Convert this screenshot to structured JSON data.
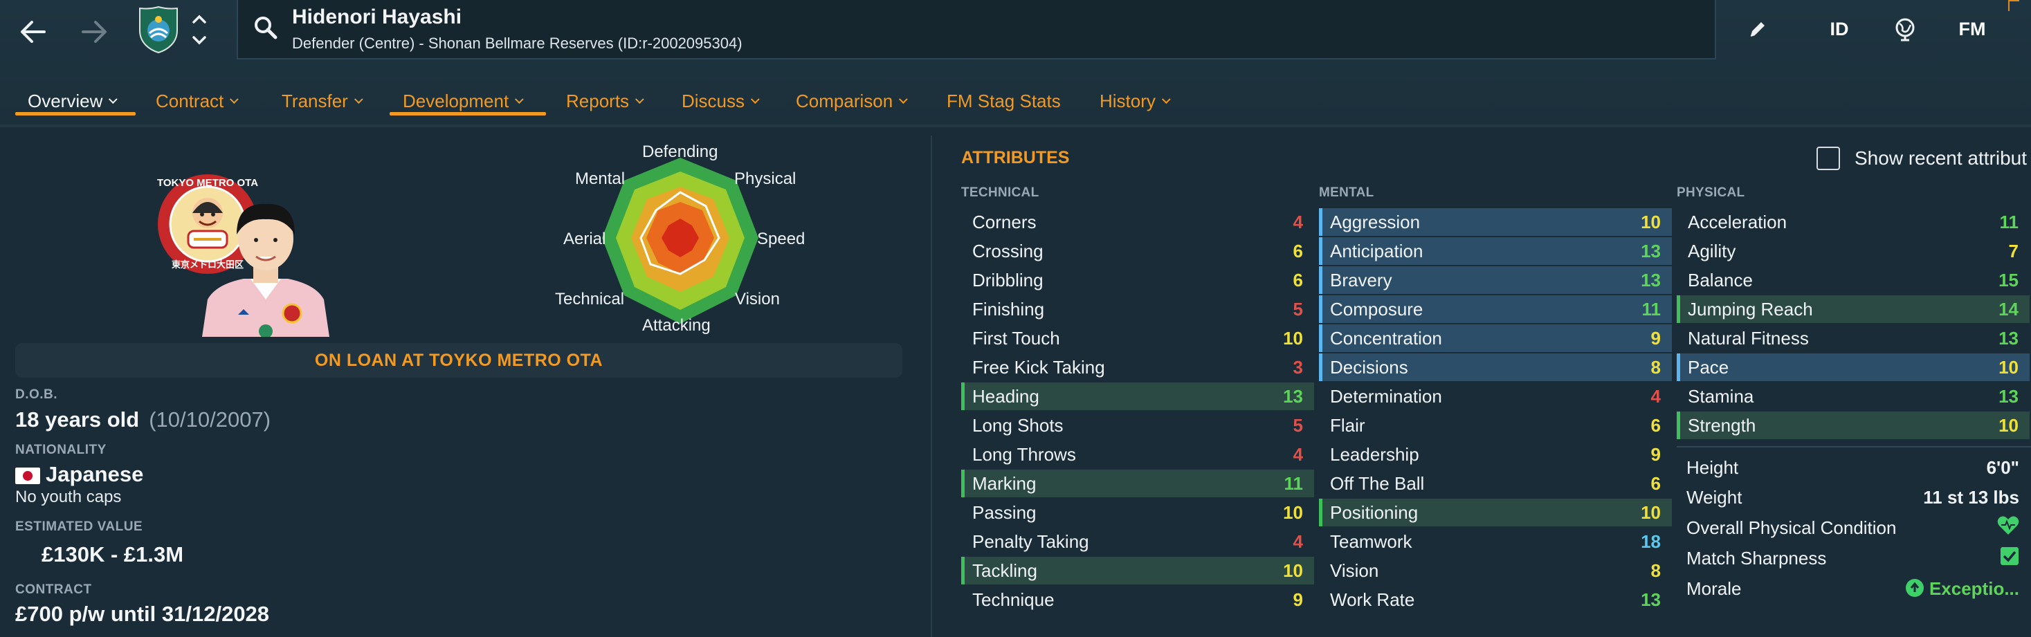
{
  "header": {
    "player_name": "Hidenori Hayashi",
    "player_subtitle": "Defender (Centre) - Shonan Bellmare Reserves (ID:r-2002095304)",
    "id_button": "ID",
    "fm_button": "FM"
  },
  "tabs": [
    {
      "label": "Overview",
      "active": true
    },
    {
      "label": "Contract"
    },
    {
      "label": "Transfer"
    },
    {
      "label": "Development",
      "highlighted": true
    },
    {
      "label": "Reports"
    },
    {
      "label": "Discuss"
    },
    {
      "label": "Comparison"
    },
    {
      "label": "FM Stag Stats"
    },
    {
      "label": "History"
    }
  ],
  "profile": {
    "loan_status": "ON LOAN AT TOYKO METRO OTA",
    "dob_label": "D.O.B.",
    "age": "18 years old",
    "dob": "(10/10/2007)",
    "nationality_label": "NATIONALITY",
    "nationality": "Japanese",
    "youth_caps": "No youth caps",
    "value_label": "ESTIMATED VALUE",
    "value": "£130K - £1.3M",
    "contract_label": "CONTRACT",
    "contract": "£700 p/w until 31/12/2028",
    "loan_club_badge_text": "TOKYO METRO OTA",
    "loan_club_badge_subtext": "東京メトロ大田区"
  },
  "radar": {
    "labels": [
      "Defending",
      "Physical",
      "Speed",
      "Vision",
      "Attacking",
      "Technical",
      "Aerial",
      "Mental"
    ]
  },
  "attributes": {
    "title": "ATTRIBUTES",
    "show_recent_label": "Show recent attribut",
    "technical_label": "TECHNICAL",
    "mental_label": "MENTAL",
    "physical_label": "PHYSICAL",
    "technical": [
      {
        "name": "Corners",
        "value": "4"
      },
      {
        "name": "Crossing",
        "value": "6"
      },
      {
        "name": "Dribbling",
        "value": "6"
      },
      {
        "name": "Finishing",
        "value": "5"
      },
      {
        "name": "First Touch",
        "value": "10"
      },
      {
        "name": "Free Kick Taking",
        "value": "3"
      },
      {
        "name": "Heading",
        "value": "13",
        "highlight": "green"
      },
      {
        "name": "Long Shots",
        "value": "5"
      },
      {
        "name": "Long Throws",
        "value": "4"
      },
      {
        "name": "Marking",
        "value": "11",
        "highlight": "green"
      },
      {
        "name": "Passing",
        "value": "10"
      },
      {
        "name": "Penalty Taking",
        "value": "4"
      },
      {
        "name": "Tackling",
        "value": "10",
        "highlight": "green"
      },
      {
        "name": "Technique",
        "value": "9"
      }
    ],
    "mental": [
      {
        "name": "Aggression",
        "value": "10",
        "highlight": "blue"
      },
      {
        "name": "Anticipation",
        "value": "13",
        "highlight": "blue"
      },
      {
        "name": "Bravery",
        "value": "13",
        "highlight": "blue"
      },
      {
        "name": "Composure",
        "value": "11",
        "highlight": "blue"
      },
      {
        "name": "Concentration",
        "value": "9",
        "highlight": "blue"
      },
      {
        "name": "Decisions",
        "value": "8",
        "highlight": "blue"
      },
      {
        "name": "Determination",
        "value": "4"
      },
      {
        "name": "Flair",
        "value": "6"
      },
      {
        "name": "Leadership",
        "value": "9"
      },
      {
        "name": "Off The Ball",
        "value": "6"
      },
      {
        "name": "Positioning",
        "value": "10",
        "highlight": "green"
      },
      {
        "name": "Teamwork",
        "value": "18"
      },
      {
        "name": "Vision",
        "value": "8"
      },
      {
        "name": "Work Rate",
        "value": "13"
      }
    ],
    "physical": [
      {
        "name": "Acceleration",
        "value": "11"
      },
      {
        "name": "Agility",
        "value": "7"
      },
      {
        "name": "Balance",
        "value": "15"
      },
      {
        "name": "Jumping Reach",
        "value": "14",
        "highlight": "green"
      },
      {
        "name": "Natural Fitness",
        "value": "13"
      },
      {
        "name": "Pace",
        "value": "10",
        "highlight": "blue"
      },
      {
        "name": "Stamina",
        "value": "13"
      },
      {
        "name": "Strength",
        "value": "10",
        "highlight": "green"
      }
    ],
    "extras": [
      {
        "name": "Height",
        "value": "6'0\""
      },
      {
        "name": "Weight",
        "value": "11 st 13 lbs"
      },
      {
        "name": "Overall Physical Condition",
        "value": "",
        "icon": "heart-icon"
      },
      {
        "name": "Match Sharpness",
        "value": "",
        "icon": "check-icon"
      },
      {
        "name": "Morale",
        "value": "Exceptio...",
        "icon": "up-arrow-icon"
      }
    ]
  },
  "colors": {
    "accent": "#f29a22",
    "val_low": "#e2504a",
    "val_mid": "#f0e03a",
    "val_good": "#5fd45a",
    "val_great": "#5bc8f0",
    "highlight_green": "#3fbf5a",
    "highlight_blue": "#5bb6f0"
  }
}
